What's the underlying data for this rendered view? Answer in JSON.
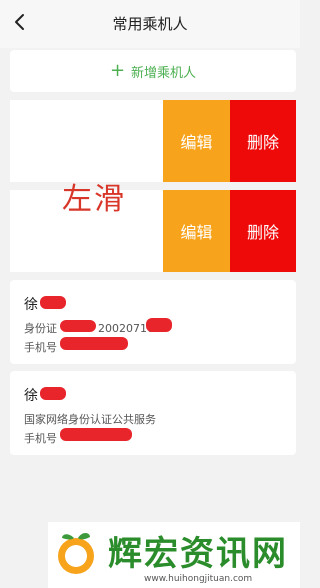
{
  "header": {
    "title": "常用乘机人"
  },
  "add_passenger": {
    "plus": "+",
    "label": "新增乘机人"
  },
  "swipe_actions": {
    "edit_label": "编辑",
    "delete_label": "删除",
    "colors": {
      "edit": "#f7a41c",
      "delete": "#ef0a0a"
    }
  },
  "overlay_text": "左滑",
  "passengers": [
    {
      "name": "徐",
      "line1_label": "身份证",
      "line1_partial": "20020710",
      "line2_label": "手机号"
    },
    {
      "name": "徐",
      "line1_label": "国家网络身份认证公共服务",
      "line2_label": "手机号"
    }
  ],
  "watermark": {
    "text": "辉宏资讯网",
    "url": "www.huihongjituan.com"
  },
  "accent_color": "#4caf50"
}
